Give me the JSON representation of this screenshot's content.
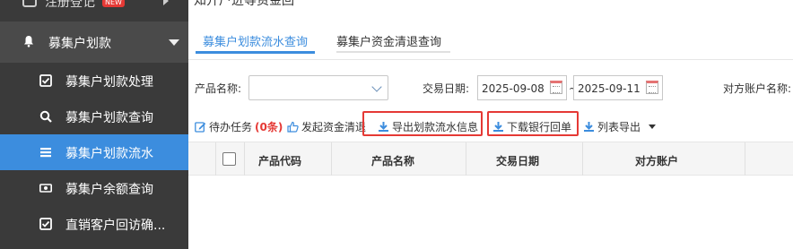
{
  "sidebar": {
    "top_item": {
      "label": "注册登记",
      "badge": "NEW"
    },
    "section": {
      "label": "募集户划款"
    },
    "items": [
      {
        "label": "募集户划款处理",
        "icon": "check-square-icon"
      },
      {
        "label": "募集户划款查询",
        "icon": "search-icon"
      },
      {
        "label": "募集户划款流水",
        "icon": "list-icon",
        "active": true
      },
      {
        "label": "募集户余额查询",
        "icon": "money-icon"
      },
      {
        "label": "直销客户回访确...",
        "icon": "check-square-icon"
      }
    ]
  },
  "main": {
    "top_text": "知开户进等资金回",
    "tabs": [
      {
        "label": "募集户划款流水查询",
        "active": true
      },
      {
        "label": "募集户资金清退查询",
        "active": false
      }
    ],
    "filters": {
      "product_name_label": "产品名称:",
      "product_name_value": "",
      "trade_date_label": "交易日期:",
      "date_from": "2025-09-08",
      "date_sep": "~",
      "date_to": "2025-09-11",
      "counterparty_label": "对方账户名称:"
    },
    "toolbar": {
      "pending_label": "待办任务",
      "pending_count": "(0条)",
      "initiate_label": "发起资金清退",
      "export_flow_label": "导出划款流水信息",
      "download_receipt_label": "下载银行回单",
      "list_export_label": "列表导出"
    },
    "table": {
      "columns": [
        "产品代码",
        "产品名称",
        "交易日期",
        "对方账户"
      ]
    }
  },
  "colors": {
    "sidebar_bg": "#3a3a3a",
    "active_blue": "#3c8dde",
    "highlight_red": "#e53935"
  }
}
